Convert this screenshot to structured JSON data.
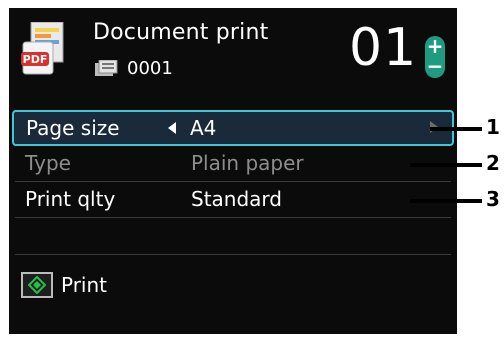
{
  "header": {
    "title": "Document print",
    "file_number": "0001",
    "copies": "01",
    "stepper_plus": "+",
    "stepper_minus": "−"
  },
  "settings": [
    {
      "label": "Page size",
      "value": "A4",
      "selected": true,
      "enabled": true
    },
    {
      "label": "Type",
      "value": "Plain paper",
      "selected": false,
      "enabled": false
    },
    {
      "label": "Print qlty",
      "value": "Standard",
      "selected": false,
      "enabled": true
    }
  ],
  "footer": {
    "start_label": "Print"
  },
  "callouts": [
    "1",
    "2",
    "3"
  ],
  "icons": {
    "document": "pdf-document-icon",
    "file": "memory-file-icon",
    "start": "start-button-icon"
  },
  "colors": {
    "accent": "#41c6d8",
    "stepper": "#1f9c80",
    "start_icon": "#23c14a",
    "pdf_badge": "#d8322f"
  }
}
